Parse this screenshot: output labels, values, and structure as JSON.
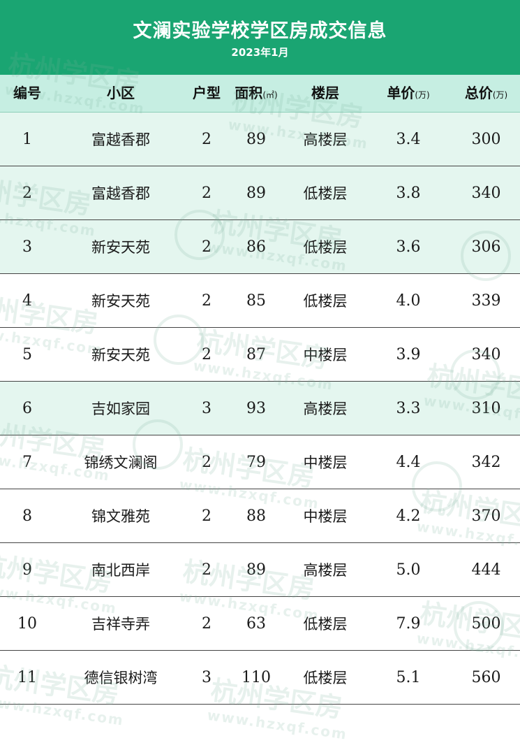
{
  "header": {
    "title": "文澜实验学校学区房成交信息",
    "subtitle": "2023年1月"
  },
  "columns": {
    "num": "编号",
    "community": "小区",
    "layout": "户型",
    "area": "面积",
    "area_unit": "(㎡)",
    "floor": "楼层",
    "unit_price": "单价",
    "unit_price_unit": "(万)",
    "total_price": "总价",
    "total_price_unit": "(万)"
  },
  "rows": [
    {
      "num": "1",
      "community": "富越香郡",
      "layout": "2",
      "area": "89",
      "floor": "高楼层",
      "unit_price": "3.4",
      "total_price": "300"
    },
    {
      "num": "2",
      "community": "富越香郡",
      "layout": "2",
      "area": "89",
      "floor": "低楼层",
      "unit_price": "3.8",
      "total_price": "340"
    },
    {
      "num": "3",
      "community": "新安天苑",
      "layout": "2",
      "area": "86",
      "floor": "低楼层",
      "unit_price": "3.6",
      "total_price": "306"
    },
    {
      "num": "4",
      "community": "新安天苑",
      "layout": "2",
      "area": "85",
      "floor": "低楼层",
      "unit_price": "4.0",
      "total_price": "339"
    },
    {
      "num": "5",
      "community": "新安天苑",
      "layout": "2",
      "area": "87",
      "floor": "中楼层",
      "unit_price": "3.9",
      "total_price": "340"
    },
    {
      "num": "6",
      "community": "吉如家园",
      "layout": "3",
      "area": "93",
      "floor": "高楼层",
      "unit_price": "3.3",
      "total_price": "310"
    },
    {
      "num": "7",
      "community": "锦绣文澜阁",
      "layout": "2",
      "area": "79",
      "floor": "中楼层",
      "unit_price": "4.4",
      "total_price": "342"
    },
    {
      "num": "8",
      "community": "锦文雅苑",
      "layout": "2",
      "area": "88",
      "floor": "中楼层",
      "unit_price": "4.2",
      "total_price": "370"
    },
    {
      "num": "9",
      "community": "南北西岸",
      "layout": "2",
      "area": "89",
      "floor": "高楼层",
      "unit_price": "5.0",
      "total_price": "444"
    },
    {
      "num": "10",
      "community": "吉祥寺弄",
      "layout": "2",
      "area": "63",
      "floor": "低楼层",
      "unit_price": "7.9",
      "total_price": "500"
    },
    {
      "num": "11",
      "community": "德信银树湾",
      "layout": "3",
      "area": "110",
      "floor": "低楼层",
      "unit_price": "5.1",
      "total_price": "560"
    }
  ],
  "watermark": {
    "text": "杭州学区房",
    "url": "www.hzxqf.com"
  },
  "colors": {
    "header_green": "#1aa572",
    "column_header_bg": "#c6eee2",
    "tinted_row_bg": "#e4f6ef"
  }
}
